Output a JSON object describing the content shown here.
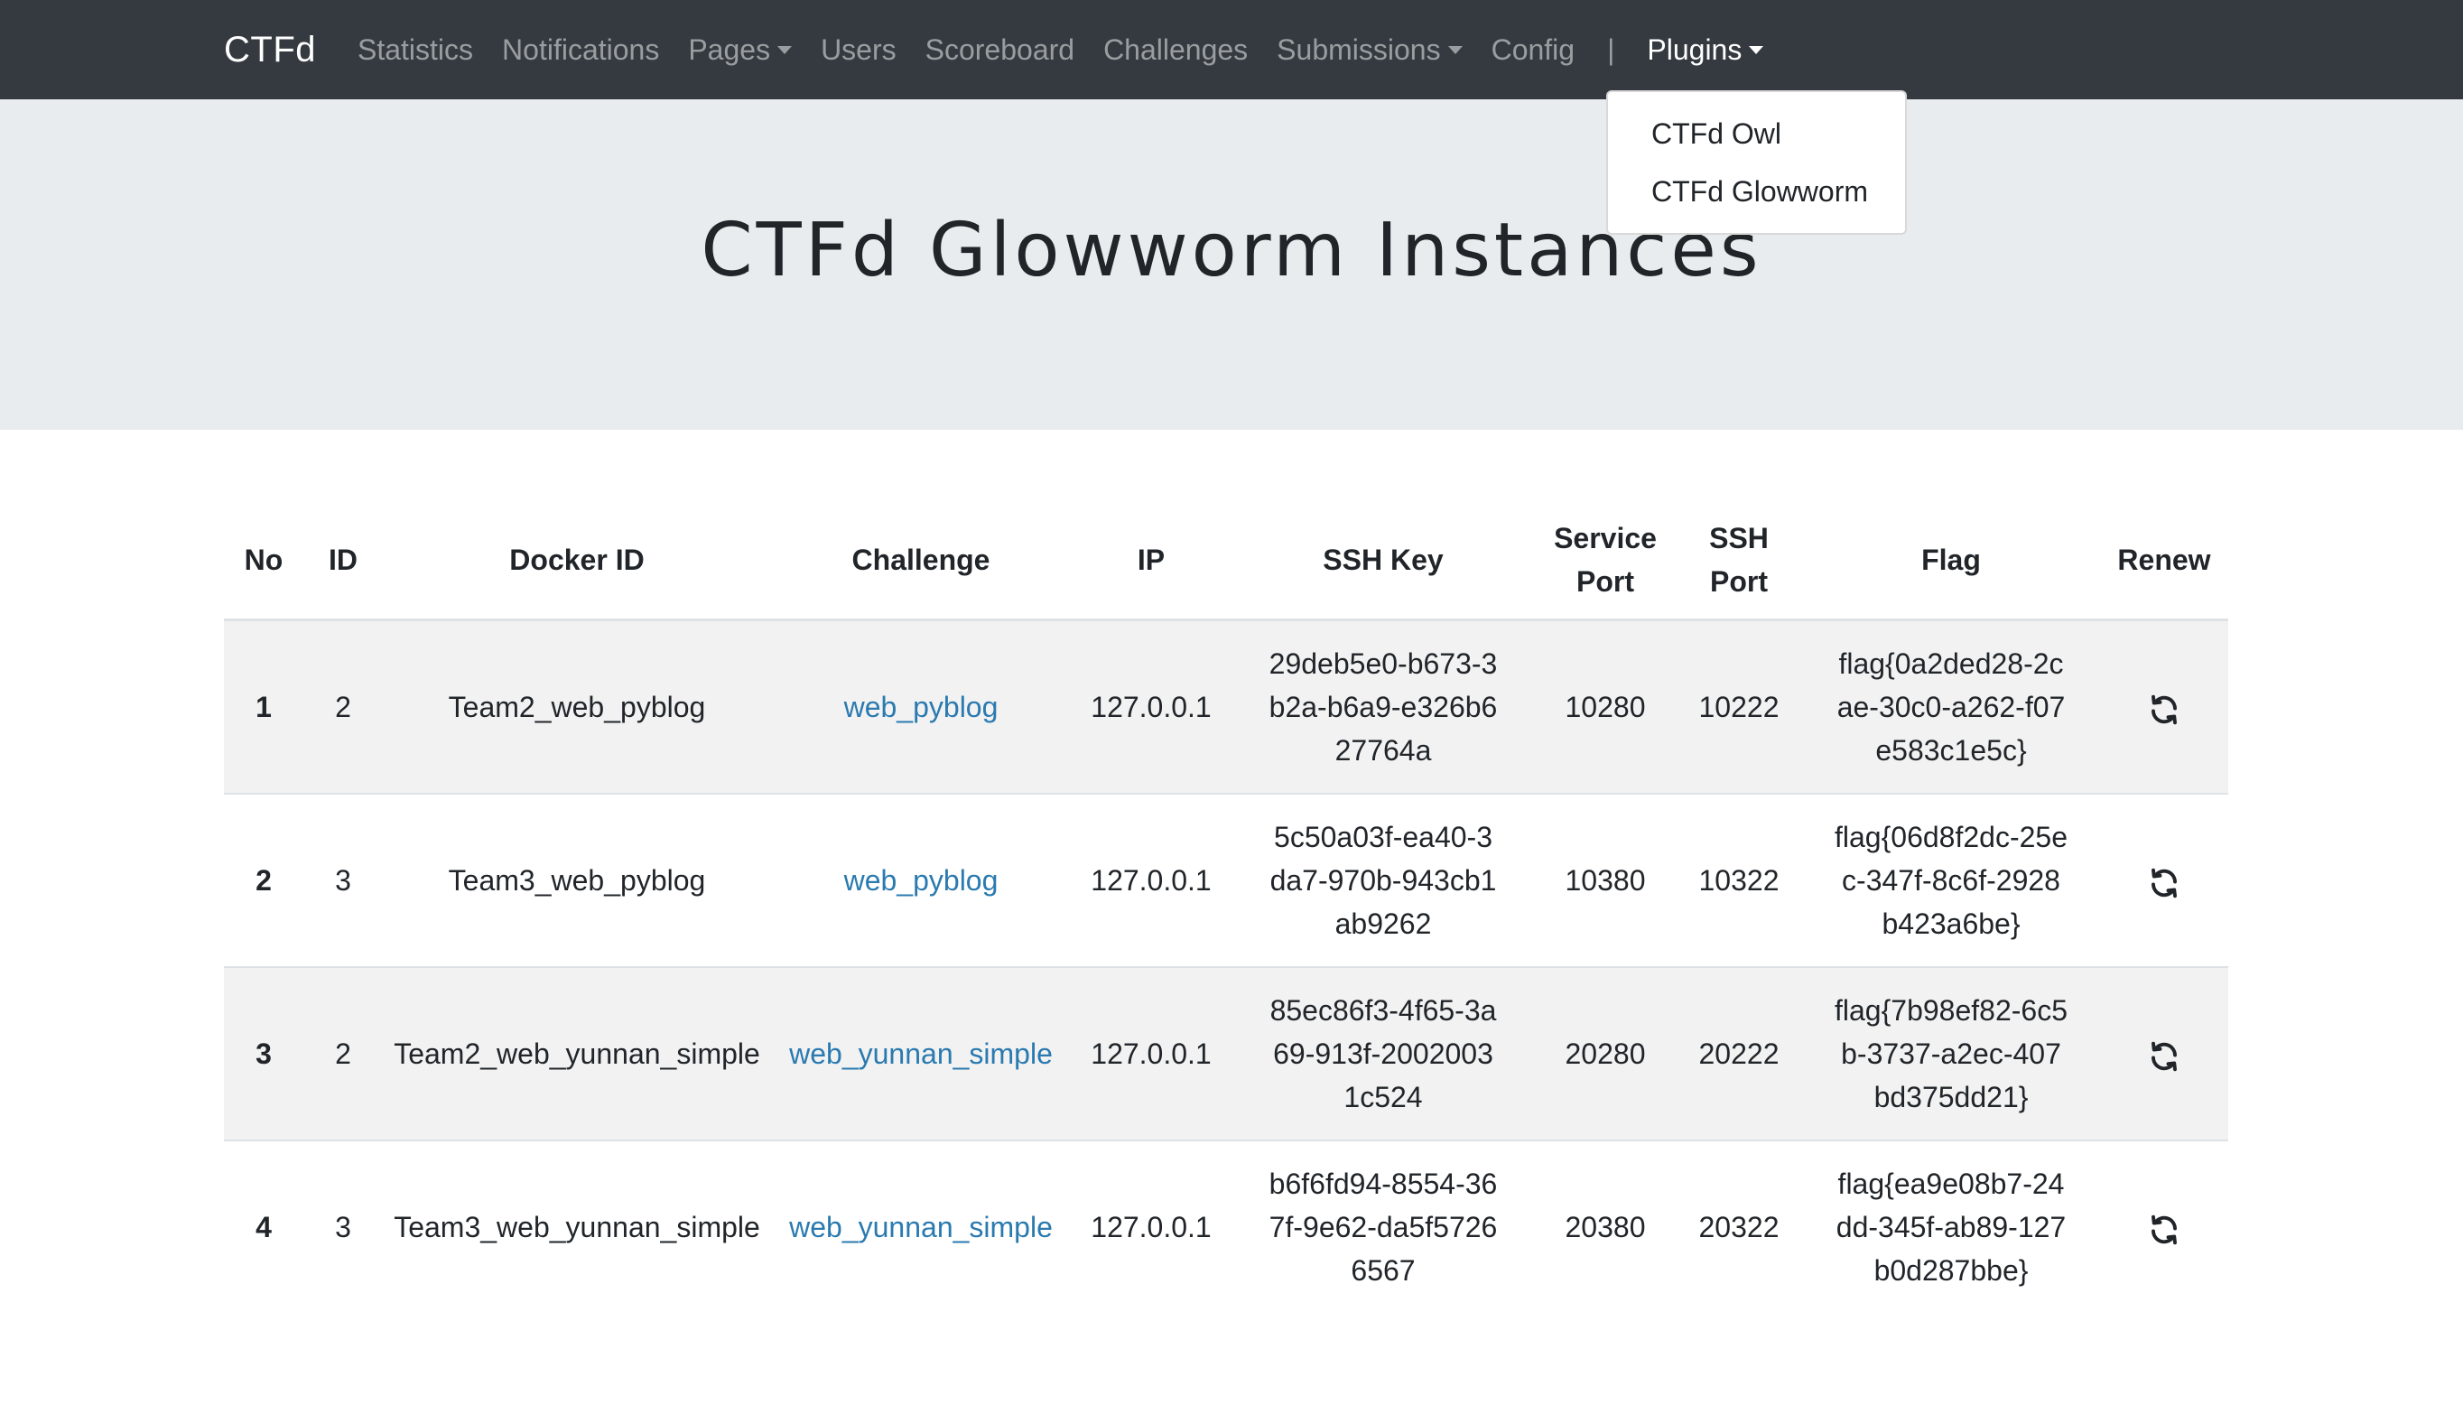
{
  "navbar": {
    "brand": "CTFd",
    "items": [
      {
        "label": "Statistics",
        "dropdown": false
      },
      {
        "label": "Notifications",
        "dropdown": false
      },
      {
        "label": "Pages",
        "dropdown": true
      },
      {
        "label": "Users",
        "dropdown": false
      },
      {
        "label": "Scoreboard",
        "dropdown": false
      },
      {
        "label": "Challenges",
        "dropdown": false
      },
      {
        "label": "Submissions",
        "dropdown": true
      },
      {
        "label": "Config",
        "dropdown": false
      }
    ],
    "separator": "|",
    "plugins_label": "Plugins"
  },
  "plugins_menu": {
    "items": [
      "CTFd Owl",
      "CTFd Glowworm"
    ]
  },
  "page": {
    "title": "CTFd Glowworm Instances"
  },
  "table": {
    "headers": [
      "No",
      "ID",
      "Docker ID",
      "Challenge",
      "IP",
      "SSH Key",
      "Service Port",
      "SSH Port",
      "Flag",
      "Renew"
    ],
    "rows": [
      {
        "no": "1",
        "id": "2",
        "docker_id": "Team2_web_pyblog",
        "challenge": "web_pyblog",
        "ip": "127.0.0.1",
        "ssh_key": "29deb5e0-b673-3b2a-b6a9-e326b627764a",
        "service_port": "10280",
        "ssh_port": "10222",
        "flag": "flag{0a2ded28-2cae-30c0-a262-f07e583c1e5c}"
      },
      {
        "no": "2",
        "id": "3",
        "docker_id": "Team3_web_pyblog",
        "challenge": "web_pyblog",
        "ip": "127.0.0.1",
        "ssh_key": "5c50a03f-ea40-3da7-970b-943cb1ab9262",
        "service_port": "10380",
        "ssh_port": "10322",
        "flag": "flag{06d8f2dc-25ec-347f-8c6f-2928b423a6be}"
      },
      {
        "no": "3",
        "id": "2",
        "docker_id": "Team2_web_yunnan_simple",
        "challenge": "web_yunnan_simple",
        "ip": "127.0.0.1",
        "ssh_key": "85ec86f3-4f65-3a69-913f-20020031c524",
        "service_port": "20280",
        "ssh_port": "20222",
        "flag": "flag{7b98ef82-6c5b-3737-a2ec-407bd375dd21}"
      },
      {
        "no": "4",
        "id": "3",
        "docker_id": "Team3_web_yunnan_simple",
        "challenge": "web_yunnan_simple",
        "ip": "127.0.0.1",
        "ssh_key": "b6f6fd94-8554-367f-9e62-da5f57266567",
        "service_port": "20380",
        "ssh_port": "20322",
        "flag": "flag{ea9e08b7-24dd-345f-ab89-127b0d287bbe}"
      }
    ],
    "renew_icon": "refresh-icon"
  },
  "colors": {
    "navbar_bg": "#343a40",
    "jumbotron_bg": "#e9ecef",
    "link": "#2a7ab0",
    "stripe": "#f2f2f2"
  }
}
